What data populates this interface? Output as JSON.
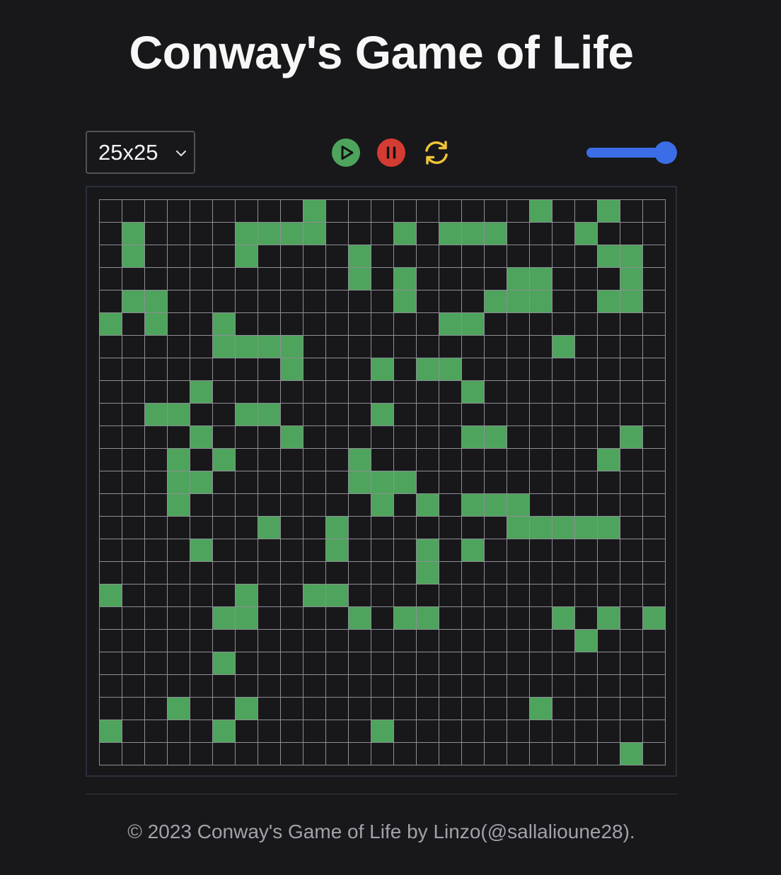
{
  "header": {
    "title": "Conway's Game of Life"
  },
  "controls": {
    "size_select": {
      "selected": "25x25"
    },
    "play_icon": "play-circle-icon",
    "pause_icon": "pause-circle-icon",
    "reset_icon": "refresh-icon",
    "speed_slider": {
      "value_fraction": 1.0
    }
  },
  "board": {
    "rows": 25,
    "cols": 25,
    "alive_color": "#4ea45c",
    "dead_color": "#18181b",
    "grid_line_color": "#8e8e96",
    "alive_cells": [
      [
        0,
        9
      ],
      [
        0,
        19
      ],
      [
        0,
        22
      ],
      [
        1,
        1
      ],
      [
        1,
        6
      ],
      [
        1,
        7
      ],
      [
        1,
        8
      ],
      [
        1,
        9
      ],
      [
        1,
        13
      ],
      [
        1,
        15
      ],
      [
        1,
        16
      ],
      [
        1,
        17
      ],
      [
        1,
        21
      ],
      [
        2,
        1
      ],
      [
        2,
        6
      ],
      [
        2,
        11
      ],
      [
        2,
        22
      ],
      [
        2,
        23
      ],
      [
        3,
        11
      ],
      [
        3,
        13
      ],
      [
        3,
        18
      ],
      [
        3,
        19
      ],
      [
        3,
        23
      ],
      [
        4,
        1
      ],
      [
        4,
        2
      ],
      [
        4,
        13
      ],
      [
        4,
        17
      ],
      [
        4,
        18
      ],
      [
        4,
        19
      ],
      [
        4,
        22
      ],
      [
        4,
        23
      ],
      [
        5,
        0
      ],
      [
        5,
        2
      ],
      [
        5,
        5
      ],
      [
        5,
        15
      ],
      [
        5,
        16
      ],
      [
        6,
        5
      ],
      [
        6,
        6
      ],
      [
        6,
        7
      ],
      [
        6,
        8
      ],
      [
        6,
        20
      ],
      [
        7,
        8
      ],
      [
        7,
        12
      ],
      [
        7,
        14
      ],
      [
        7,
        15
      ],
      [
        8,
        4
      ],
      [
        8,
        16
      ],
      [
        9,
        2
      ],
      [
        9,
        3
      ],
      [
        9,
        6
      ],
      [
        9,
        7
      ],
      [
        9,
        12
      ],
      [
        10,
        4
      ],
      [
        10,
        8
      ],
      [
        10,
        16
      ],
      [
        10,
        17
      ],
      [
        10,
        23
      ],
      [
        11,
        3
      ],
      [
        11,
        5
      ],
      [
        11,
        11
      ],
      [
        11,
        22
      ],
      [
        12,
        3
      ],
      [
        12,
        4
      ],
      [
        12,
        11
      ],
      [
        12,
        12
      ],
      [
        12,
        13
      ],
      [
        13,
        3
      ],
      [
        13,
        12
      ],
      [
        13,
        14
      ],
      [
        13,
        16
      ],
      [
        13,
        17
      ],
      [
        13,
        18
      ],
      [
        14,
        7
      ],
      [
        14,
        10
      ],
      [
        14,
        18
      ],
      [
        14,
        19
      ],
      [
        14,
        20
      ],
      [
        14,
        21
      ],
      [
        14,
        22
      ],
      [
        15,
        4
      ],
      [
        15,
        10
      ],
      [
        15,
        14
      ],
      [
        15,
        16
      ],
      [
        16,
        14
      ],
      [
        17,
        0
      ],
      [
        17,
        6
      ],
      [
        17,
        9
      ],
      [
        17,
        10
      ],
      [
        18,
        5
      ],
      [
        18,
        6
      ],
      [
        18,
        11
      ],
      [
        18,
        13
      ],
      [
        18,
        14
      ],
      [
        18,
        20
      ],
      [
        18,
        22
      ],
      [
        18,
        24
      ],
      [
        19,
        21
      ],
      [
        20,
        5
      ],
      [
        22,
        3
      ],
      [
        22,
        6
      ],
      [
        22,
        19
      ],
      [
        23,
        0
      ],
      [
        23,
        5
      ],
      [
        23,
        12
      ],
      [
        24,
        23
      ]
    ]
  },
  "footer": {
    "text": "© 2023 Conway's Game of Life by Linzo(@sallalioune28)."
  }
}
